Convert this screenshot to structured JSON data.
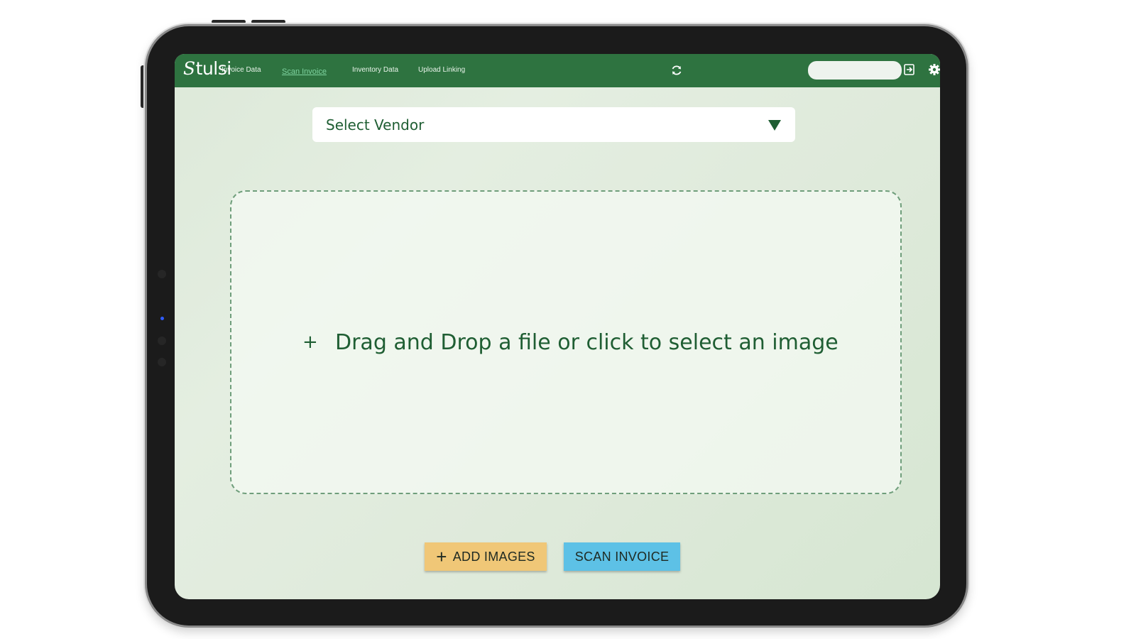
{
  "app": {
    "logo_text": "tulsi",
    "logo_mark": "S"
  },
  "nav": {
    "items": [
      {
        "label": "Invoice Data",
        "active": false
      },
      {
        "label": "Scan Invoice",
        "active": true
      },
      {
        "label": "Inventory Data",
        "active": false
      },
      {
        "label": "Upload Linking",
        "active": false
      }
    ],
    "search_value": "",
    "icons": [
      "refresh-icon",
      "logout-icon",
      "settings-icon"
    ]
  },
  "vendor_select": {
    "selected": "Select Vendor"
  },
  "dropzone": {
    "plus": "+",
    "text": "Drag and Drop a file or click to select an image"
  },
  "actions": {
    "add_images_plus": "+",
    "add_images": "ADD IMAGES",
    "scan_invoice": "SCAN INVOICE"
  },
  "colors": {
    "navbar": "#2e7340",
    "accent_text": "#1f5e33",
    "add_button": "#f0c777",
    "scan_button": "#5dc1e6",
    "background": "#dfeadb"
  }
}
